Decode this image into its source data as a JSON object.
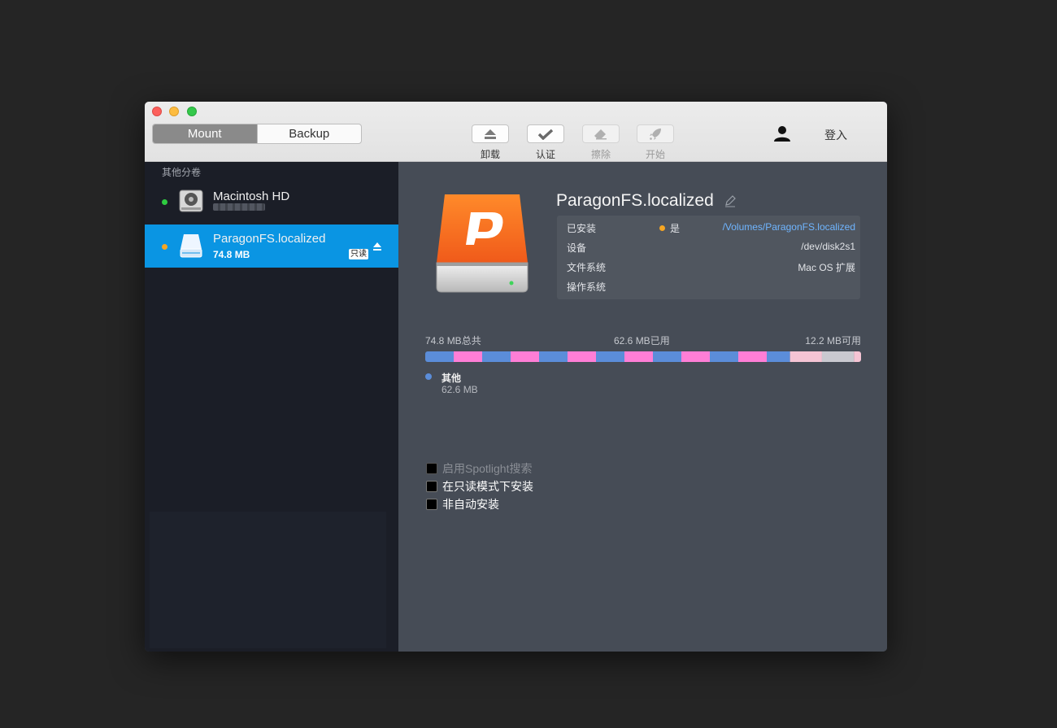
{
  "window": {
    "controls": [
      "close",
      "minimize",
      "zoom"
    ]
  },
  "toolbar": {
    "segments": [
      {
        "label": "Mount",
        "active": true
      },
      {
        "label": "Backup",
        "active": false
      }
    ],
    "tools": [
      {
        "label": "卸载",
        "icon": "eject-icon",
        "enabled": true
      },
      {
        "label": "认证",
        "icon": "checkmark-icon",
        "enabled": true
      },
      {
        "label": "擦除",
        "icon": "eraser-icon",
        "enabled": false
      },
      {
        "label": "开始",
        "icon": "rocket-icon",
        "enabled": false
      }
    ],
    "user_icon": "user-icon",
    "login_label": "登入"
  },
  "sidebar": {
    "section_title": "其他分卷",
    "volumes": [
      {
        "name": "Macintosh HD",
        "status_color": "#2ecc40",
        "icon": "hard-drive-icon",
        "selected": false
      },
      {
        "name": "ParagonFS.localized",
        "size": "74.8 MB",
        "badge": "只读",
        "status_color": "#f6a623",
        "icon": "external-drive-icon",
        "selected": true,
        "eject_icon": "eject-icon"
      }
    ]
  },
  "main": {
    "title": "ParagonFS.localized",
    "info": {
      "mounted_label": "已安装",
      "mounted_value": "是",
      "mount_path": "/Volumes/ParagonFS.localized",
      "device_label": "设备",
      "device_value": "/dev/disk2s1",
      "fs_label": "文件系统",
      "fs_value": "Mac OS 扩展",
      "os_label": "操作系统",
      "os_value": ""
    },
    "capacity": {
      "total": "74.8 MB总共",
      "used": "62.6 MB已用",
      "free": "12.2 MB可用",
      "used_fraction": 0.837,
      "colors": {
        "blue": "#5b8dd9",
        "pink": "#ff7ed6",
        "free_pink": "#f5c4d4",
        "free_grey": "#c9c9d0"
      }
    },
    "legend": {
      "name": "其他",
      "size": "62.6 MB",
      "color": "#5b8dd9"
    },
    "options": [
      {
        "label": "启用Spotlight搜索",
        "enabled": false,
        "checked": false
      },
      {
        "label": "在只读模式下安装",
        "enabled": true,
        "checked": false
      },
      {
        "label": "非自动安装",
        "enabled": true,
        "checked": false
      }
    ]
  }
}
